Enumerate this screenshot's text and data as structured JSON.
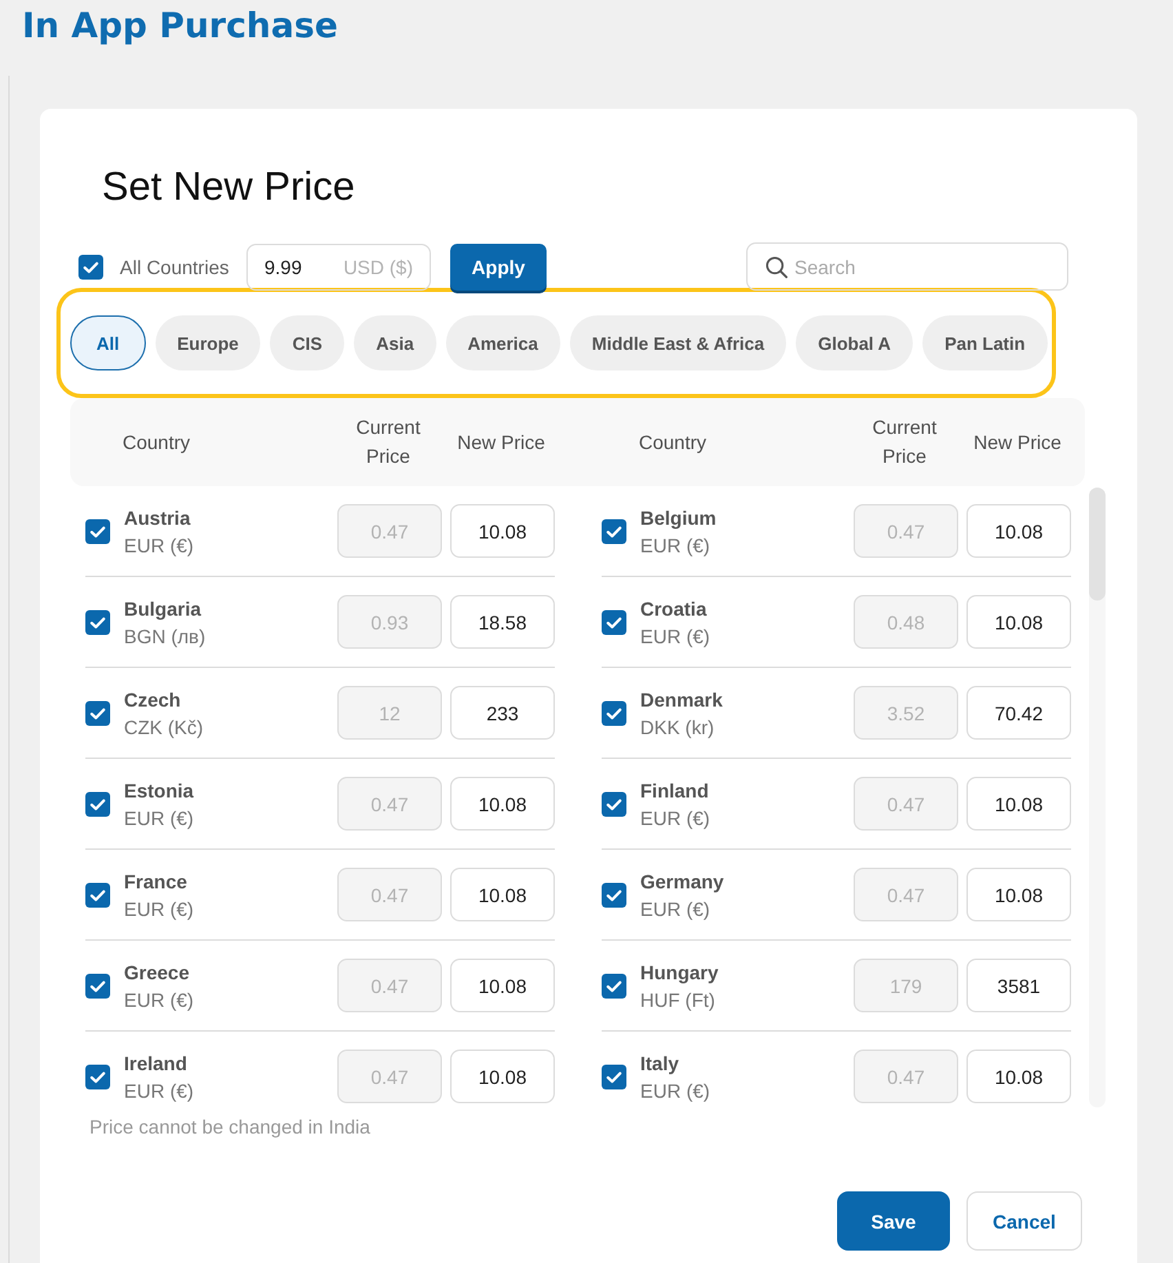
{
  "page": {
    "title": "In App Purchase"
  },
  "dialog": {
    "title": "Set New Price",
    "all_countries": {
      "label": "All Countries",
      "checked": true
    },
    "price_field": {
      "value": "9.99",
      "unit": "USD ($)"
    },
    "apply_button": {
      "label": "Apply"
    },
    "search": {
      "placeholder": "Search"
    },
    "region_filter": {
      "highlighted": true,
      "tabs": [
        {
          "label": "All",
          "selected": true
        },
        {
          "label": "Europe",
          "selected": false
        },
        {
          "label": "CIS",
          "selected": false
        },
        {
          "label": "Asia",
          "selected": false
        },
        {
          "label": "America",
          "selected": false
        },
        {
          "label": "Middle East & Africa",
          "selected": false
        },
        {
          "label": "Global A",
          "selected": false
        },
        {
          "label": "Pan Latin",
          "selected": false
        }
      ]
    },
    "table": {
      "columns": [
        "Country",
        "Current Price",
        "New Price",
        "Country",
        "Current Price",
        "New Price"
      ],
      "countries": [
        {
          "name": "Austria",
          "currency": "EUR (€)",
          "current_price": "0.47",
          "new_price": "10.08",
          "checked": true
        },
        {
          "name": "Belgium",
          "currency": "EUR (€)",
          "current_price": "0.47",
          "new_price": "10.08",
          "checked": true
        },
        {
          "name": "Bulgaria",
          "currency": "BGN (лв)",
          "current_price": "0.93",
          "new_price": "18.58",
          "checked": true
        },
        {
          "name": "Croatia",
          "currency": "EUR (€)",
          "current_price": "0.48",
          "new_price": "10.08",
          "checked": true
        },
        {
          "name": "Czech",
          "currency": "CZK (Kč)",
          "current_price": "12",
          "new_price": "233",
          "checked": true
        },
        {
          "name": "Denmark",
          "currency": "DKK (kr)",
          "current_price": "3.52",
          "new_price": "70.42",
          "checked": true
        },
        {
          "name": "Estonia",
          "currency": "EUR (€)",
          "current_price": "0.47",
          "new_price": "10.08",
          "checked": true
        },
        {
          "name": "Finland",
          "currency": "EUR (€)",
          "current_price": "0.47",
          "new_price": "10.08",
          "checked": true
        },
        {
          "name": "France",
          "currency": "EUR (€)",
          "current_price": "0.47",
          "new_price": "10.08",
          "checked": true
        },
        {
          "name": "Germany",
          "currency": "EUR (€)",
          "current_price": "0.47",
          "new_price": "10.08",
          "checked": true
        },
        {
          "name": "Greece",
          "currency": "EUR (€)",
          "current_price": "0.47",
          "new_price": "10.08",
          "checked": true
        },
        {
          "name": "Hungary",
          "currency": "HUF (Ft)",
          "current_price": "179",
          "new_price": "3581",
          "checked": true
        },
        {
          "name": "Ireland",
          "currency": "EUR (€)",
          "current_price": "0.47",
          "new_price": "10.08",
          "checked": true
        },
        {
          "name": "Italy",
          "currency": "EUR (€)",
          "current_price": "0.47",
          "new_price": "10.08",
          "checked": true
        }
      ]
    },
    "note": "Price cannot be changed in India",
    "buttons": [
      {
        "label": "Save",
        "kind": "primary"
      },
      {
        "label": "Cancel",
        "kind": "secondary"
      }
    ]
  }
}
